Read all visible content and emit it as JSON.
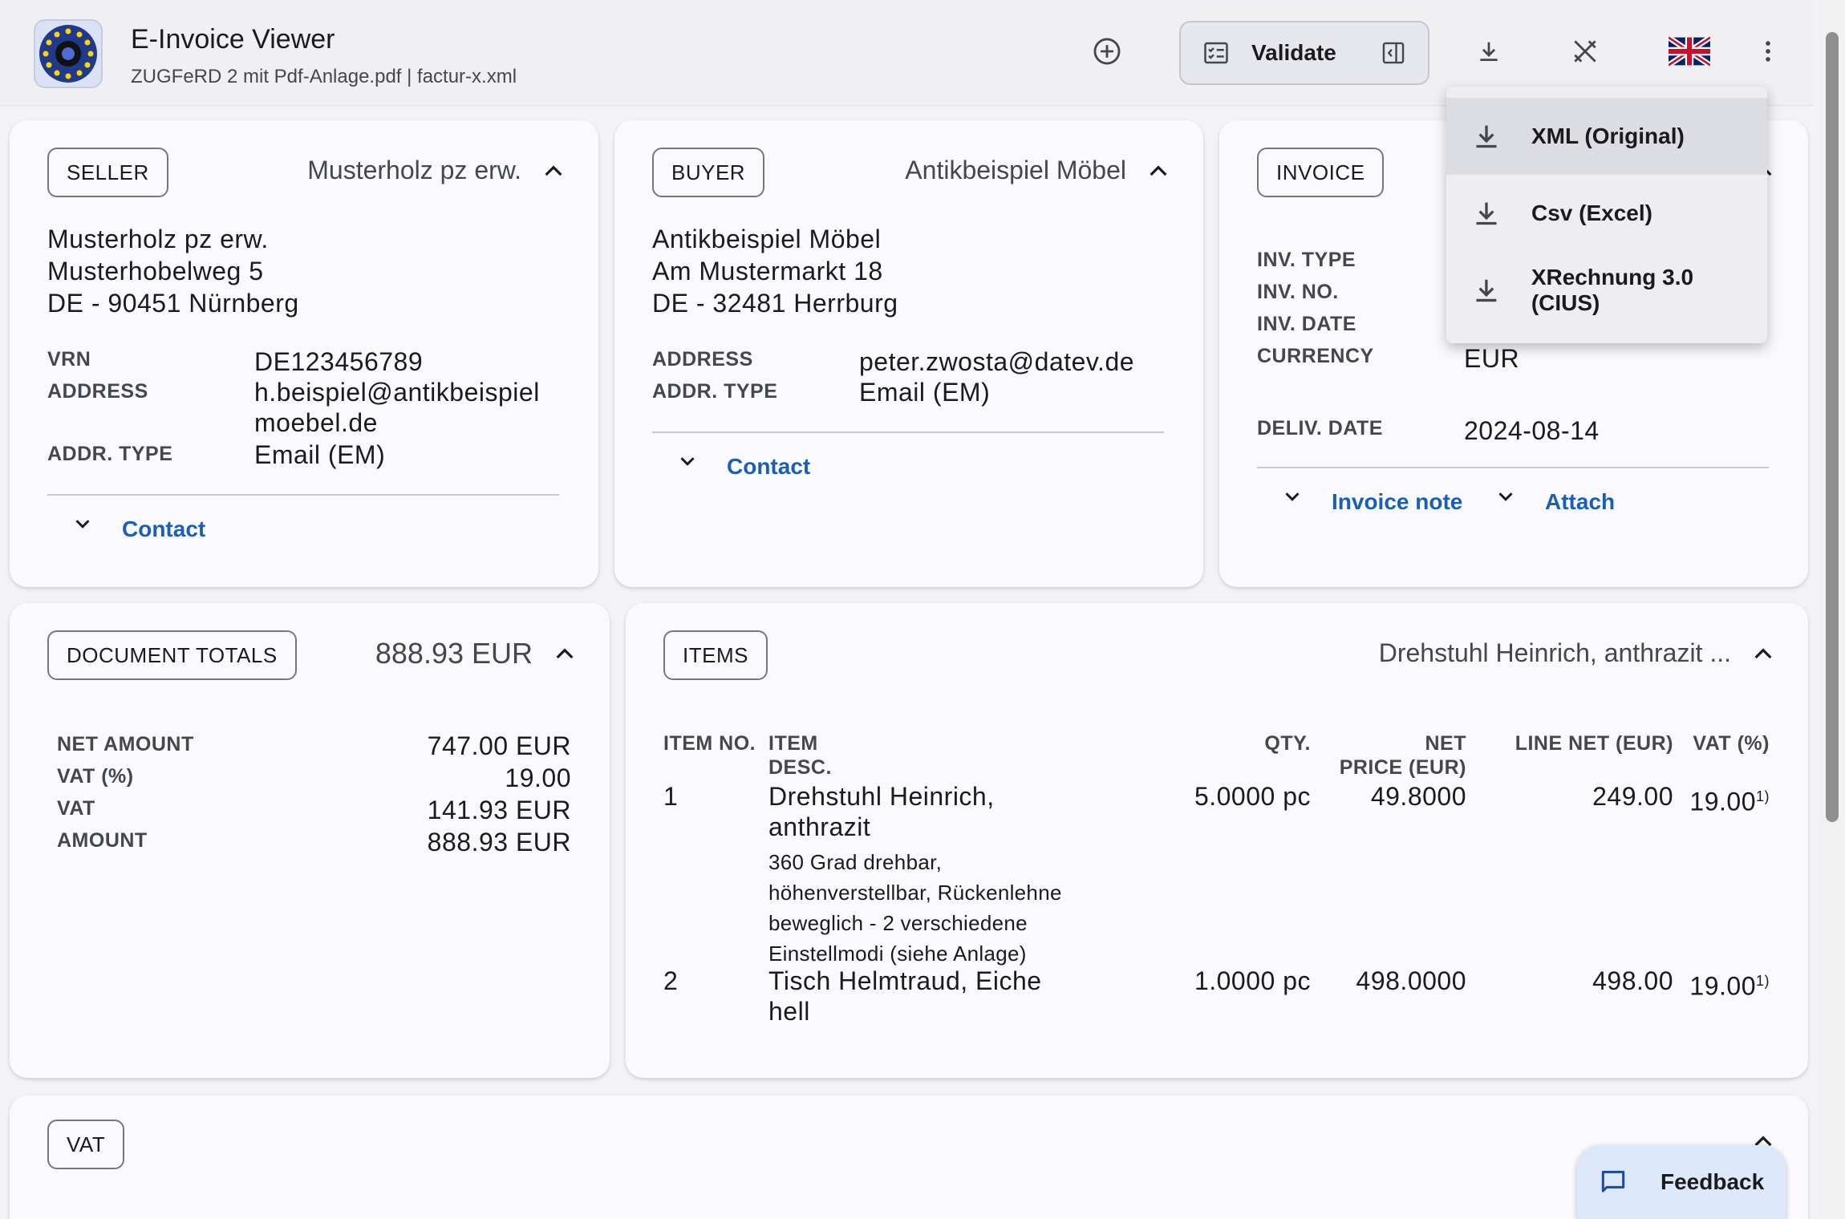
{
  "app": {
    "title": "E-Invoice Viewer",
    "subtitle": "ZUGFeRD 2 mit Pdf-Anlage.pdf | factur-x.xml"
  },
  "toolbar": {
    "validate_label": "Validate"
  },
  "download_menu": {
    "items": [
      {
        "label": "XML (Original)"
      },
      {
        "label": "Csv (Excel)"
      },
      {
        "label": "XRechnung 3.0 (CIUS)"
      }
    ]
  },
  "seller": {
    "chip": "SELLER",
    "head": "Musterholz pz erw.",
    "address_lines": [
      "Musterholz pz erw.",
      "Musterhobelweg 5",
      "DE - 90451 Nürnberg"
    ],
    "vrn_label": "VRN",
    "vrn": "DE123456789",
    "address_label": "ADDRESS",
    "address_value_1": "h.beispiel@antikbeispiel",
    "address_value_2": "moebel.de",
    "addr_type_label": "ADDR. TYPE",
    "addr_type": "Email (EM)",
    "contact_label": "Contact"
  },
  "buyer": {
    "chip": "BUYER",
    "head": "Antikbeispiel Möbel",
    "address_lines": [
      "Antikbeispiel Möbel",
      "Am Mustermarkt 18",
      "DE - 32481 Herrburg"
    ],
    "address_label": "ADDRESS",
    "address_value": "peter.zwosta@datev.de",
    "addr_type_label": "ADDR. TYPE",
    "addr_type": "Email (EM)",
    "contact_label": "Contact"
  },
  "invoice": {
    "chip": "INVOICE",
    "type_label": "INV. TYPE",
    "no_label": "INV. NO.",
    "date_label": "INV. DATE",
    "currency_label": "CURRENCY",
    "currency": "EUR",
    "deliv_label": "DELIV. DATE",
    "deliv_date": "2024-08-14",
    "note_label": "Invoice note",
    "attach_label": "Attach"
  },
  "totals": {
    "chip": "DOCUMENT TOTALS",
    "head": "888.93 EUR",
    "rows": [
      {
        "label": "NET AMOUNT",
        "value": "747.00 EUR"
      },
      {
        "label": "VAT (%)",
        "value": "19.00"
      },
      {
        "label": "VAT",
        "value": "141.93 EUR"
      },
      {
        "label": "AMOUNT",
        "value": "888.93 EUR"
      }
    ]
  },
  "items": {
    "chip": "ITEMS",
    "head": "Drehstuhl Heinrich, anthrazit ...",
    "headers": {
      "item_no": "ITEM NO.",
      "item_1": "ITEM",
      "item_2": "DESC.",
      "qty": "QTY.",
      "price_1": "NET",
      "price_2": "PRICE (EUR)",
      "line_net": "LINE NET (EUR)",
      "vat": "VAT (%)"
    },
    "rows": [
      {
        "no": "1",
        "name_1": "Drehstuhl Heinrich,",
        "name_2": "anthrazit",
        "desc": [
          "360 Grad drehbar,",
          "höhenverstellbar, Rückenlehne",
          "beweglich - 2 verschiedene",
          "Einstellmodi (siehe Anlage)"
        ],
        "qty": "5.0000 pc",
        "price": "49.8000",
        "line_net": "249.00",
        "vat": "19.00",
        "vat_note": "1)"
      },
      {
        "no": "2",
        "name_1": "Tisch Helmtraud, Eiche",
        "name_2": "hell",
        "qty": "1.0000 pc",
        "price": "498.0000",
        "line_net": "498.00",
        "vat": "19.00",
        "vat_note": "1)"
      }
    ]
  },
  "vat_section": {
    "chip": "VAT"
  },
  "feedback": {
    "label": "Feedback"
  },
  "colors": {
    "accent": "#1a5fb4",
    "card": "#fafafe",
    "background": "#f3f3f7"
  }
}
